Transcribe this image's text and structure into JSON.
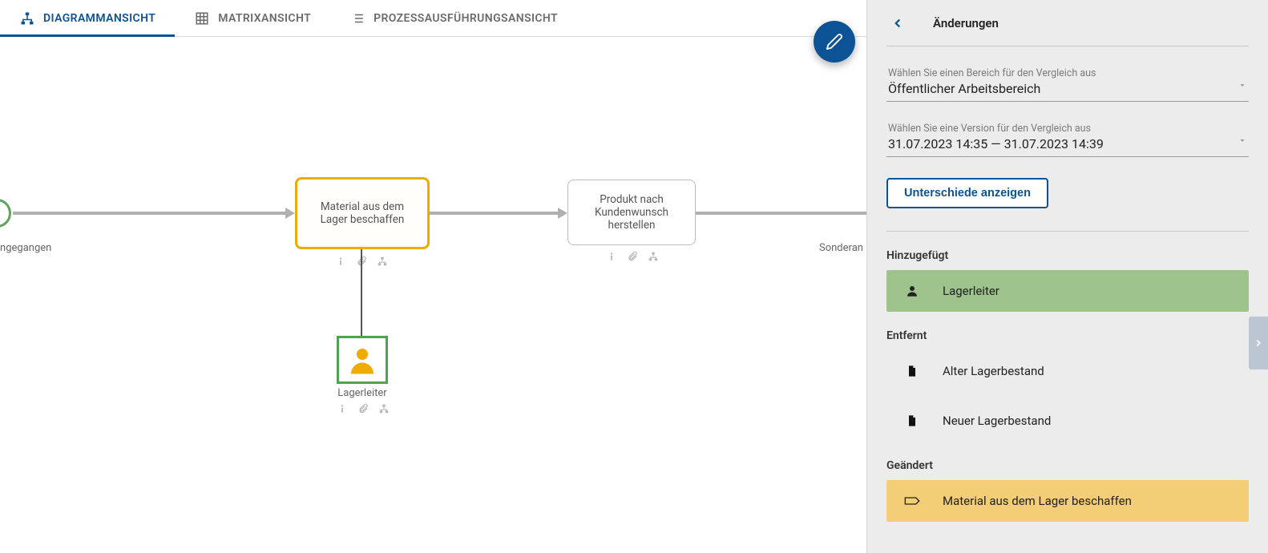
{
  "tabs": {
    "diagram": "DIAGRAMMANSICHT",
    "matrix": "MATRIXANSICHT",
    "execution": "PROZESSAUSFÜHRUNGSANSICHT",
    "active": "diagram"
  },
  "diagram": {
    "start_event_label": "eingegangen",
    "task1": "Material aus dem Lager beschaffen",
    "task2": "Produkt nach Kundenwunsch herstellen",
    "role1": "Lagerleiter",
    "right_edge_label": "Sonderan"
  },
  "panel": {
    "title": "Änderungen",
    "compare_area_label": "Wählen Sie einen Bereich für den Vergleich aus",
    "compare_area_value": "Öffentlicher Arbeitsbereich",
    "compare_version_label": "Wählen Sie eine Version für den Vergleich aus",
    "compare_version_value": "31.07.2023 14:35 — 31.07.2023 14:39",
    "show_diff_button": "Unterschiede anzeigen",
    "sections": {
      "added": {
        "label": "Hinzugefügt",
        "items": [
          {
            "icon": "person",
            "text": "Lagerleiter"
          }
        ]
      },
      "removed": {
        "label": "Entfernt",
        "items": [
          {
            "icon": "document",
            "text": "Alter Lagerbestand"
          },
          {
            "icon": "document",
            "text": "Neuer Lagerbestand"
          }
        ]
      },
      "changed": {
        "label": "Geändert",
        "items": [
          {
            "icon": "process",
            "text": "Material aus dem Lager beschaffen"
          }
        ]
      }
    }
  }
}
